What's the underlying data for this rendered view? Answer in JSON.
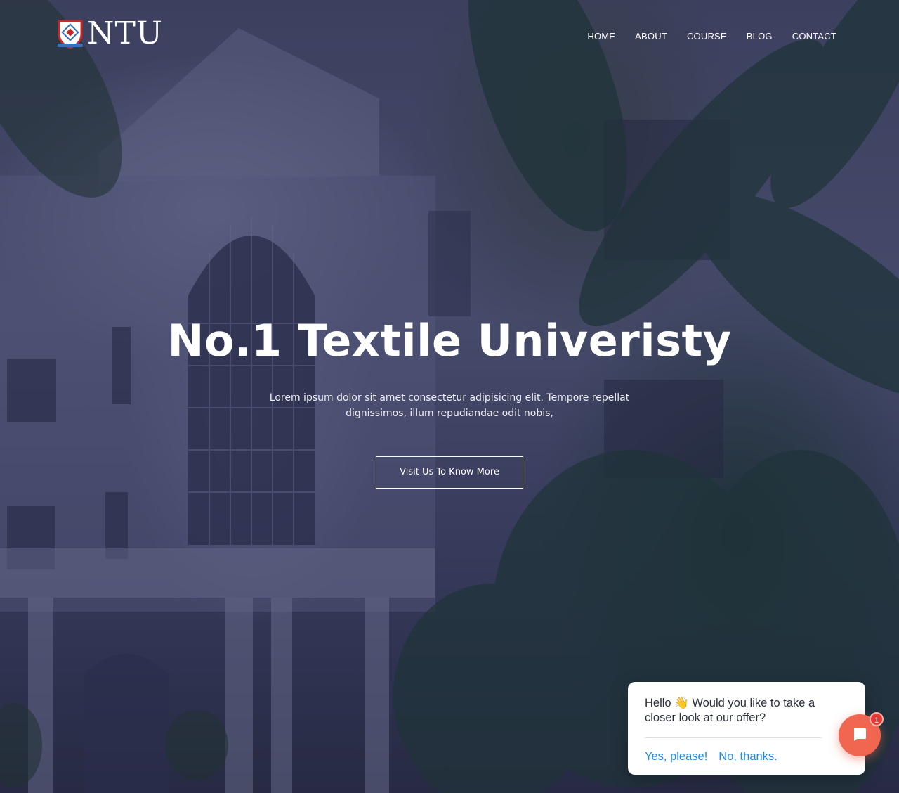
{
  "brand": {
    "name": "NTU"
  },
  "nav": {
    "items": [
      "HOME",
      "ABOUT",
      "COURSE",
      "BLOG",
      "CONTACT"
    ]
  },
  "hero": {
    "title": "No.1 Textile Univeristy",
    "subtitle": "Lorem ipsum dolor sit amet consectetur adipisicing elit. Tempore repellat dignissimos, illum repudiandae odit nobis,",
    "cta_label": "Visit Us To Know More"
  },
  "chat": {
    "message": "Hello 👋 Would you like to take a closer look at our offer?",
    "accept_label": "Yes, please!",
    "decline_label": "No, thanks.",
    "badge_count": "1",
    "accent_color": "#f06650",
    "link_color": "#1e88e5"
  },
  "icons": {
    "logo": "shield-crest-icon",
    "launcher": "chat-bubble-icon"
  }
}
